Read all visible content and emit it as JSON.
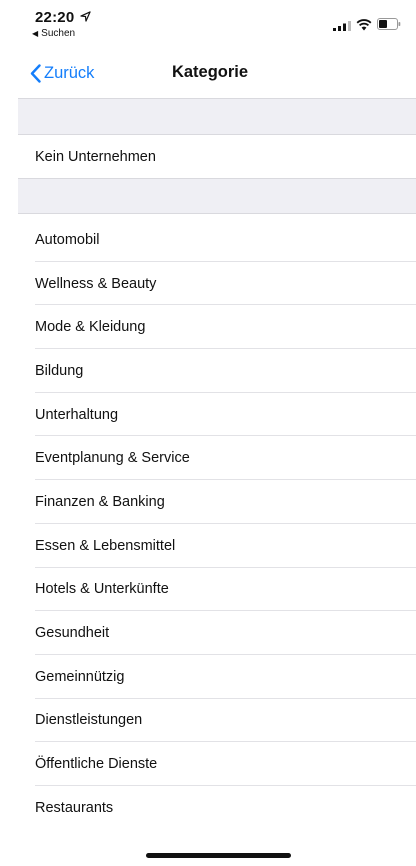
{
  "status_bar": {
    "time": "22:20",
    "back_app": "Suchen",
    "icons": [
      "location-arrow-icon",
      "signal-icon",
      "wifi-icon",
      "battery-icon"
    ]
  },
  "nav": {
    "back_label": "Zurück",
    "title": "Kategorie"
  },
  "top_option": "Kein Unternehmen",
  "categories": [
    "Automobil",
    "Wellness & Beauty",
    "Mode & Kleidung",
    "Bildung",
    "Unterhaltung",
    "Eventplanung & Service",
    "Finanzen & Banking",
    "Essen & Lebensmittel",
    "Hotels & Unterkünfte",
    "Gesundheit",
    "Gemeinnützig",
    "Dienstleistungen",
    "Öffentliche Dienste",
    "Restaurants"
  ],
  "colors": {
    "accent": "#147efb",
    "group_background": "#efeff4",
    "text": "#111111"
  }
}
